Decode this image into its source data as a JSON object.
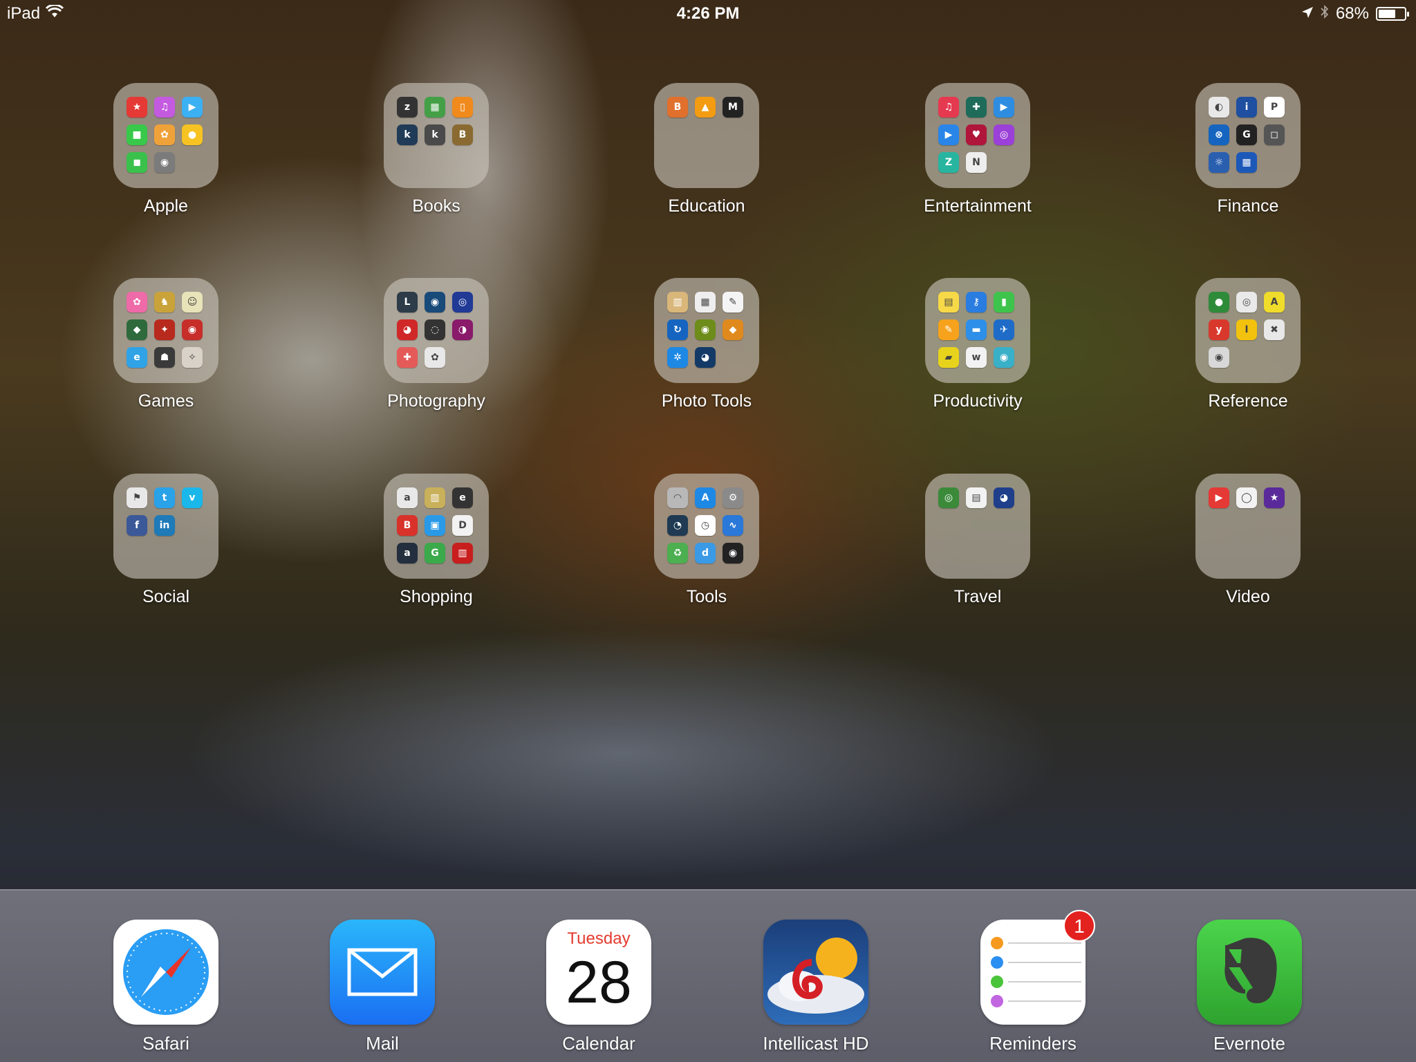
{
  "status_bar": {
    "device": "iPad",
    "time": "4:26 PM",
    "battery_percent": "68%",
    "battery_level": 0.68
  },
  "folders": [
    {
      "label": "Apple",
      "icons": [
        {
          "g": "★",
          "c": "#e53935"
        },
        {
          "g": "♫",
          "c": "#c45ae0"
        },
        {
          "g": "▶",
          "c": "#3bb0f2"
        },
        {
          "g": "■",
          "c": "#38c94a"
        },
        {
          "g": "✿",
          "c": "#f0a23a"
        },
        {
          "g": "●",
          "c": "#f6c323"
        },
        {
          "g": "◼",
          "c": "#3ac14c"
        },
        {
          "g": "◉",
          "c": "#7b7b7b"
        }
      ]
    },
    {
      "label": "Books",
      "icons": [
        {
          "g": "z",
          "c": "#333333"
        },
        {
          "g": "▦",
          "c": "#43a047"
        },
        {
          "g": "▯",
          "c": "#f08a1c"
        },
        {
          "g": "k",
          "c": "#1f3b57"
        },
        {
          "g": "k",
          "c": "#4a4a4a"
        },
        {
          "g": "B",
          "c": "#8a6a30"
        }
      ]
    },
    {
      "label": "Education",
      "icons": [
        {
          "g": "B",
          "c": "#e0702c"
        },
        {
          "g": "▲",
          "c": "#f39c12"
        },
        {
          "g": "M",
          "c": "#222222"
        }
      ]
    },
    {
      "label": "Entertainment",
      "icons": [
        {
          "g": "♫",
          "c": "#e53950"
        },
        {
          "g": "✚",
          "c": "#1e6b5a"
        },
        {
          "g": "▶",
          "c": "#2e8de0"
        },
        {
          "g": "▶",
          "c": "#2a85e8"
        },
        {
          "g": "♥",
          "c": "#b0163a"
        },
        {
          "g": "◎",
          "c": "#9b40d8"
        },
        {
          "g": "Z",
          "c": "#28b5a0"
        },
        {
          "g": "N",
          "c": "#eeeeee"
        }
      ]
    },
    {
      "label": "Finance",
      "icons": [
        {
          "g": "◐",
          "c": "#e8e8e8"
        },
        {
          "g": "i",
          "c": "#1e4fa0"
        },
        {
          "g": "P",
          "c": "#ffffff"
        },
        {
          "g": "⊗",
          "c": "#1565c0"
        },
        {
          "g": "G",
          "c": "#222222"
        },
        {
          "g": "◻",
          "c": "#555555"
        },
        {
          "g": "☼",
          "c": "#2a5fb0"
        },
        {
          "g": "▦",
          "c": "#1c58b8"
        }
      ]
    },
    {
      "label": "Games",
      "icons": [
        {
          "g": "✿",
          "c": "#ef6aa8"
        },
        {
          "g": "♞",
          "c": "#c9a33a"
        },
        {
          "g": "☺",
          "c": "#e8e3b8"
        },
        {
          "g": "◆",
          "c": "#2f6a3c"
        },
        {
          "g": "✦",
          "c": "#b82a1e"
        },
        {
          "g": "◉",
          "c": "#c72e2a"
        },
        {
          "g": "e",
          "c": "#2fa3e6"
        },
        {
          "g": "☗",
          "c": "#3a3a3a"
        },
        {
          "g": "✧",
          "c": "#d8d2c8"
        }
      ]
    },
    {
      "label": "Photography",
      "icons": [
        {
          "g": "L",
          "c": "#2d3c48"
        },
        {
          "g": "◉",
          "c": "#184a7a"
        },
        {
          "g": "◎",
          "c": "#203a96"
        },
        {
          "g": "◕",
          "c": "#d02828"
        },
        {
          "g": "◌",
          "c": "#333333"
        },
        {
          "g": "◑",
          "c": "#8a1a6a"
        },
        {
          "g": "✚",
          "c": "#e45a58"
        },
        {
          "g": "✿",
          "c": "#e8e8e8"
        }
      ]
    },
    {
      "label": "Photo Tools",
      "icons": [
        {
          "g": "▥",
          "c": "#d9b67a"
        },
        {
          "g": "▦",
          "c": "#eeeeee"
        },
        {
          "g": "✎",
          "c": "#f4f4f4"
        },
        {
          "g": "↻",
          "c": "#1565c0"
        },
        {
          "g": "◉",
          "c": "#6d8c1a"
        },
        {
          "g": "◆",
          "c": "#e08a1e"
        },
        {
          "g": "✲",
          "c": "#1e88e5"
        },
        {
          "g": "◕",
          "c": "#133a66"
        }
      ]
    },
    {
      "label": "Productivity",
      "icons": [
        {
          "g": "▤",
          "c": "#f7d948"
        },
        {
          "g": "⚷",
          "c": "#2a7de0"
        },
        {
          "g": "▮",
          "c": "#3ec44c"
        },
        {
          "g": "✎",
          "c": "#f6a21c"
        },
        {
          "g": "▬",
          "c": "#2d8fe8"
        },
        {
          "g": "✈",
          "c": "#1e6cc8"
        },
        {
          "g": "▰",
          "c": "#e8d31c"
        },
        {
          "g": "w",
          "c": "#f2f2f2"
        },
        {
          "g": "◉",
          "c": "#3ab0c8"
        }
      ]
    },
    {
      "label": "Reference",
      "icons": [
        {
          "g": "●",
          "c": "#2e8b3a"
        },
        {
          "g": "◎",
          "c": "#e9e9e9"
        },
        {
          "g": "A",
          "c": "#f0dc2a"
        },
        {
          "g": "y",
          "c": "#d9382c"
        },
        {
          "g": "I",
          "c": "#f2c20e"
        },
        {
          "g": "✖",
          "c": "#e8e8e8"
        },
        {
          "g": "◉",
          "c": "#d8d8d8"
        }
      ]
    },
    {
      "label": "Social",
      "icons": [
        {
          "g": "⚑",
          "c": "#e8e8e8"
        },
        {
          "g": "t",
          "c": "#2aa2e8"
        },
        {
          "g": "v",
          "c": "#1ab7ea"
        },
        {
          "g": "f",
          "c": "#3b5998"
        },
        {
          "g": "in",
          "c": "#1f7ab8"
        }
      ]
    },
    {
      "label": "Shopping",
      "icons": [
        {
          "g": "a",
          "c": "#e8e8e8"
        },
        {
          "g": "▥",
          "c": "#c9b05a"
        },
        {
          "g": "e",
          "c": "#333333"
        },
        {
          "g": "B",
          "c": "#d8322a"
        },
        {
          "g": "▣",
          "c": "#2a9ae8"
        },
        {
          "g": "D",
          "c": "#f2f2f2"
        },
        {
          "g": "a",
          "c": "#232f3e"
        },
        {
          "g": "G",
          "c": "#3aaa4a"
        },
        {
          "g": "▥",
          "c": "#c81e1e"
        }
      ]
    },
    {
      "label": "Tools",
      "icons": [
        {
          "g": "◠",
          "c": "#b8b8b8"
        },
        {
          "g": "A",
          "c": "#1e88e5"
        },
        {
          "g": "⚙",
          "c": "#8a8a8a"
        },
        {
          "g": "◔",
          "c": "#1f3a52"
        },
        {
          "g": "◷",
          "c": "#ffffff"
        },
        {
          "g": "∿",
          "c": "#2a78d8"
        },
        {
          "g": "♻",
          "c": "#4caf50"
        },
        {
          "g": "d",
          "c": "#3a9ae6"
        },
        {
          "g": "◉",
          "c": "#222222"
        }
      ]
    },
    {
      "label": "Travel",
      "icons": [
        {
          "g": "◎",
          "c": "#3a8a3a"
        },
        {
          "g": "▤",
          "c": "#f2f2f2"
        },
        {
          "g": "◕",
          "c": "#1f3f8a"
        }
      ]
    },
    {
      "label": "Video",
      "icons": [
        {
          "g": "▶",
          "c": "#e53935"
        },
        {
          "g": "◯",
          "c": "#f2f2f2"
        },
        {
          "g": "★",
          "c": "#5a2a9a"
        }
      ]
    }
  ],
  "dock": [
    {
      "label": "Safari",
      "icon": "safari-icon"
    },
    {
      "label": "Mail",
      "icon": "mail-icon"
    },
    {
      "label": "Calendar",
      "icon": "calendar-icon",
      "weekday": "Tuesday",
      "day": "28"
    },
    {
      "label": "Intellicast HD",
      "icon": "weather-icon"
    },
    {
      "label": "Reminders",
      "icon": "reminders-icon",
      "badge": "1"
    },
    {
      "label": "Evernote",
      "icon": "elephant-icon"
    }
  ],
  "colors": {
    "badge": "#e3211e",
    "calendar_weekday": "#e43b2f",
    "mail_blue": "#1a8cf8",
    "evernote_green": "#3cb53a"
  }
}
